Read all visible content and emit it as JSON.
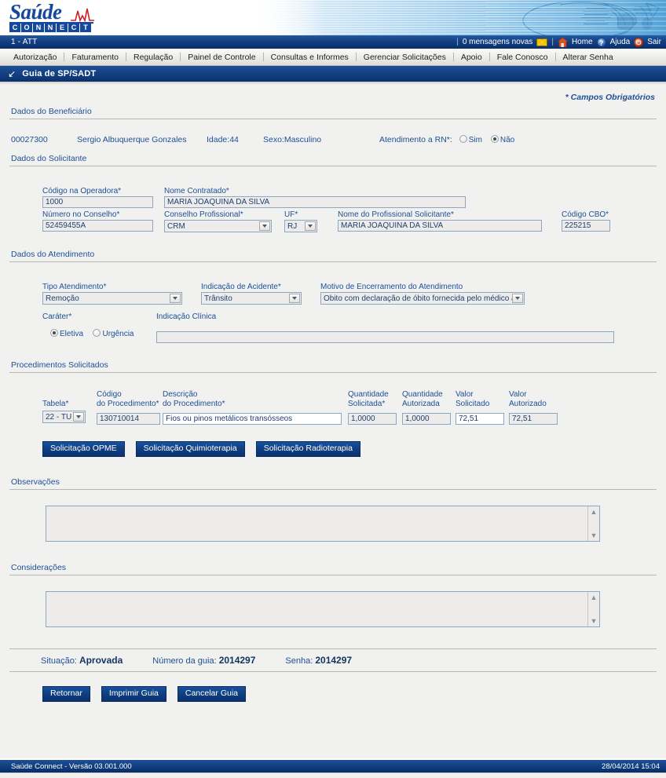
{
  "brand": {
    "name": "Saúde",
    "connect_letters": [
      "C",
      "O",
      "N",
      "N",
      "E",
      "C",
      "T"
    ]
  },
  "userbar": {
    "user": "1 - ATT",
    "messages": "0 mensagens novas",
    "home": "Home",
    "help": "Ajuda",
    "exit": "Sair",
    "sep": "|"
  },
  "menu": {
    "items": [
      "Autorização",
      "Faturamento",
      "Regulação",
      "Painel de Controle",
      "Consultas e Informes",
      "Gerenciar Solicitações",
      "Apoio",
      "Fale Conosco",
      "Alterar Senha"
    ]
  },
  "page": {
    "title": "Guia de SP/SADT",
    "required_note": "* Campos Obrigatórios"
  },
  "beneficiary": {
    "section": "Dados do Beneficiário",
    "code": "00027300",
    "name": "Sergio Albuquerque Gonzales",
    "age": "Idade:44",
    "sex": "Sexo:Masculino",
    "rn_label": "Atendimento a RN*:",
    "rn_yes": "Sim",
    "rn_no": "Não",
    "rn_selected": "Não"
  },
  "solicitante": {
    "section": "Dados do Solicitante",
    "codigo_operadora_label": "Código na Operadora*",
    "codigo_operadora_value": "1000",
    "nome_contratado_label": "Nome Contratado*",
    "nome_contratado_value": "MARIA JOAQUINA DA SILVA",
    "numero_conselho_label": "Número no Conselho*",
    "numero_conselho_value": "52459455A",
    "conselho_profissional_label": "Conselho Profissional*",
    "conselho_profissional_value": "CRM",
    "uf_label": "UF*",
    "uf_value": "RJ",
    "nome_profissional_label": "Nome do Profissional Solicitante*",
    "nome_profissional_value": "MARIA JOAQUINA DA SILVA",
    "cbo_label": "Código CBO*",
    "cbo_value": "225215"
  },
  "atendimento": {
    "section": "Dados do Atendimento",
    "tipo_label": "Tipo Atendimento*",
    "tipo_value": "Remoção",
    "acidente_label": "Indicação de Acidente*",
    "acidente_value": "Trânsito",
    "motivo_label": "Motivo de Encerramento do Atendimento",
    "motivo_value": "Obito com declaração de óbito fornecida pelo médico assistente",
    "carater_label": "Caráter*",
    "carater_eletiva": "Eletiva",
    "carater_urgencia": "Urgência",
    "carater_selected": "Eletiva",
    "indicacao_clinica_label": "Indicação Clínica",
    "indicacao_clinica_value": ""
  },
  "procedimentos": {
    "section": "Procedimentos Solicitados",
    "columns": {
      "tabela": "Tabela*",
      "codigo_l1": "Código",
      "codigo_l2": "do Procedimento*",
      "descricao_l1": "Descrição",
      "descricao_l2": "do Procedimento*",
      "qtd_sol_l1": "Quantidade",
      "qtd_sol_l2": "Solicitada*",
      "qtd_aut_l1": "Quantidade",
      "qtd_aut_l2": "Autorizada",
      "val_sol_l1": "Valor",
      "val_sol_l2": "Solicitado",
      "val_aut_l1": "Valor",
      "val_aut_l2": "Autorizado"
    },
    "rows": [
      {
        "tabela": "22 - TU",
        "codigo": "130710014",
        "descricao": "Fios ou pinos metálicos transósseos",
        "quantidade_solicitada": "1,0000",
        "quantidade_autorizada": "1,0000",
        "valor_solicitado": "72,51",
        "valor_autorizado": "72,51"
      }
    ],
    "buttons": {
      "opme": "Solicitação OPME",
      "quimio": "Solicitação Quimioterapia",
      "radio": "Solicitação Radioterapia"
    }
  },
  "observacoes": {
    "section": "Observações",
    "value": ""
  },
  "consideracoes": {
    "section": "Considerações",
    "value": ""
  },
  "status": {
    "situacao_label": "Situação:",
    "situacao_value": "Aprovada",
    "numero_label": "Número da guia:",
    "numero_value": "2014297",
    "senha_label": "Senha:",
    "senha_value": "2014297"
  },
  "actions": {
    "retornar": "Retornar",
    "imprimir": "Imprimir Guia",
    "cancelar": "Cancelar Guia"
  },
  "footer": {
    "left": "Saúde Connect - Versão 03.001.000",
    "right": "28/04/2014 15:04"
  }
}
